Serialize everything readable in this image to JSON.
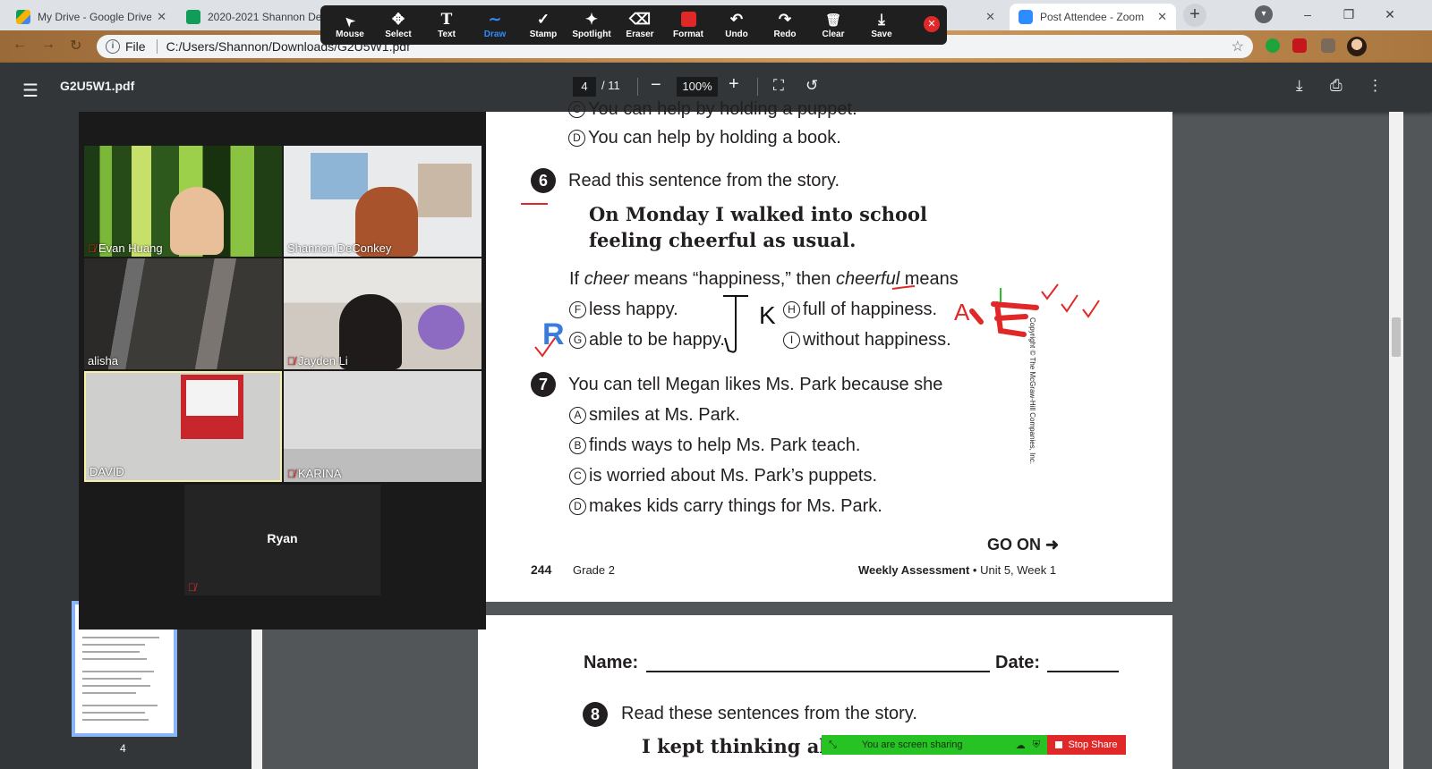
{
  "browser": {
    "tabs": [
      {
        "label": "My Drive - Google Drive",
        "color": "#f4b400"
      },
      {
        "label": "2020-2021 Shannon De",
        "color": "#0f9d58"
      },
      {
        "label": "Post Attendee - Zoom",
        "color": "#2d8cff"
      }
    ],
    "new_tab_icon": "+",
    "window_controls": [
      "–",
      "❐",
      "✕"
    ],
    "address": {
      "scheme": "File",
      "url": "C:/Users/Shannon/Downloads/G2U5W1.pdf"
    }
  },
  "annotation_toolbar": {
    "tools": [
      {
        "label": "Mouse",
        "icon": "cursor-icon",
        "glyph": "➤",
        "active": false
      },
      {
        "label": "Select",
        "icon": "move-icon",
        "glyph": "✥",
        "active": false
      },
      {
        "label": "Text",
        "icon": "text-icon",
        "glyph": "T",
        "active": false
      },
      {
        "label": "Draw",
        "icon": "draw-icon",
        "glyph": "∼",
        "active": true
      },
      {
        "label": "Stamp",
        "icon": "stamp-icon",
        "glyph": "✓",
        "active": false
      },
      {
        "label": "Spotlight",
        "icon": "spotlight-icon",
        "glyph": "✦",
        "active": false
      },
      {
        "label": "Eraser",
        "icon": "eraser-icon",
        "glyph": "⌫",
        "active": false
      },
      {
        "label": "Format",
        "icon": "format-icon",
        "glyph": "■",
        "active": false
      },
      {
        "label": "Undo",
        "icon": "undo-icon",
        "glyph": "↶",
        "active": false
      },
      {
        "label": "Redo",
        "icon": "redo-icon",
        "glyph": "↷",
        "active": false
      },
      {
        "label": "Clear",
        "icon": "trash-icon",
        "glyph": "🗑",
        "active": false
      },
      {
        "label": "Save",
        "icon": "save-icon",
        "glyph": "⤓",
        "active": false
      }
    ],
    "format_color": "#e02828"
  },
  "pdf": {
    "title": "G2U5W1.pdf",
    "current_page": "4",
    "total_pages": "/ 11",
    "zoom": "100%",
    "thumbnail_page": "4"
  },
  "page4": {
    "prev_option_partial": "You can help by holding a puppet.",
    "prev_option_d": {
      "letter": "D",
      "text": "You can help by holding a book."
    },
    "q6": {
      "number": "6",
      "prompt": "Read this sentence from the story.",
      "quote_line1": "On Monday I walked into school",
      "quote_line2": "feeling cheerful as usual.",
      "stem_pre": "If",
      "stem_word1": "cheer",
      "stem_mid": "means “happiness,” then",
      "stem_word2": "cheerful",
      "stem_post": "means",
      "options": [
        {
          "letter": "F",
          "text": "less happy."
        },
        {
          "letter": "H",
          "text": "full of happiness."
        },
        {
          "letter": "G",
          "text": "able to be happy."
        },
        {
          "letter": "I",
          "text": "without happiness."
        }
      ]
    },
    "q7": {
      "number": "7",
      "prompt": "You can tell Megan likes Ms. Park because she",
      "options": [
        {
          "letter": "A",
          "text": "smiles at Ms. Park."
        },
        {
          "letter": "B",
          "text": "finds ways to help Ms. Park teach."
        },
        {
          "letter": "C",
          "text": "is worried about Ms. Park’s puppets."
        },
        {
          "letter": "D",
          "text": "makes kids carry things for Ms. Park."
        }
      ]
    },
    "go_on": "GO ON ➜",
    "page_number": "244",
    "grade": "Grade 2",
    "assessment": "Weekly Assessment",
    "unit": "• Unit 5, Week 1",
    "copyright": "Copyright © The McGraw-Hill Companies, Inc."
  },
  "page5": {
    "name_label": "Name:",
    "date_label": "Date:",
    "q8": {
      "number": "8",
      "prompt": "Read these sentences from the story.",
      "quote_partial": "I kept thinking ab"
    }
  },
  "annotations": {
    "letters": [
      "R",
      "K",
      "A"
    ]
  },
  "zoom_gallery": {
    "participants": [
      {
        "name": "Evan Huang",
        "muted": true
      },
      {
        "name": "Shannon DeConkey",
        "muted": false
      },
      {
        "name": "alisha",
        "muted": false
      },
      {
        "name": "Jayden Li",
        "muted": true
      },
      {
        "name": "DAVID",
        "muted": false
      },
      {
        "name": "KARINA",
        "muted": true
      }
    ],
    "video_off_participant": {
      "name": "Ryan",
      "muted": true
    },
    "active_speaker_color": "#f5f0a3"
  },
  "share_bar": {
    "status": "You are screen sharing",
    "stop_label": "Stop Share"
  }
}
